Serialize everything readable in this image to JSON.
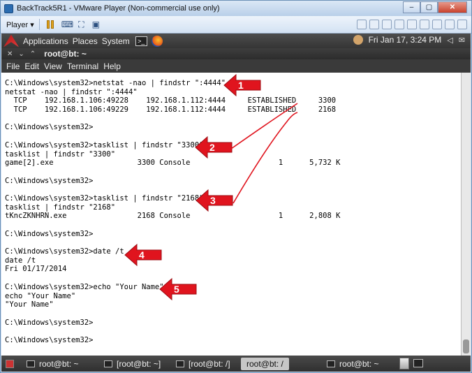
{
  "window": {
    "title": "BackTrack5R1 - VMware Player (Non-commercial use only)"
  },
  "toolbar": {
    "player_label": "Player ▾"
  },
  "panel": {
    "menus": [
      "Applications",
      "Places",
      "System"
    ],
    "clock": "Fri Jan 17,  3:24 PM"
  },
  "terminal": {
    "title": "root@bt: ~",
    "menu": [
      "File",
      "Edit",
      "View",
      "Terminal",
      "Help"
    ],
    "lines": [
      "C:\\Windows\\system32>netstat -nao | findstr \":4444\"",
      "netstat -nao | findstr \":4444\"",
      "  TCP    192.168.1.106:49228    192.168.1.112:4444     ESTABLISHED     3300",
      "  TCP    192.168.1.106:49229    192.168.1.112:4444     ESTABLISHED     2168",
      "",
      "C:\\Windows\\system32>",
      "",
      "C:\\Windows\\system32>tasklist | findstr \"3300\"",
      "tasklist | findstr \"3300\"",
      "game[2].exe                   3300 Console                    1      5,732 K",
      "",
      "C:\\Windows\\system32>",
      "",
      "C:\\Windows\\system32>tasklist | findstr \"2168\"",
      "tasklist | findstr \"2168\"",
      "tKncZKNHRN.exe                2168 Console                    1      2,808 K",
      "",
      "C:\\Windows\\system32>",
      "",
      "C:\\Windows\\system32>date /t",
      "date /t",
      "Fri 01/17/2014",
      "",
      "C:\\Windows\\system32>echo \"Your Name\"",
      "echo \"Your Name\"",
      "\"Your Name\"",
      "",
      "C:\\Windows\\system32>",
      "",
      "C:\\Windows\\system32>"
    ]
  },
  "annotations": [
    "1",
    "2",
    "3",
    "4",
    "5"
  ],
  "annotation_color": "#e0141e",
  "taskbar": {
    "tasks": [
      "root@bt: ~",
      "[root@bt: ~]",
      "[root@bt: /]",
      "root@bt: /",
      "root@bt: ~"
    ]
  }
}
